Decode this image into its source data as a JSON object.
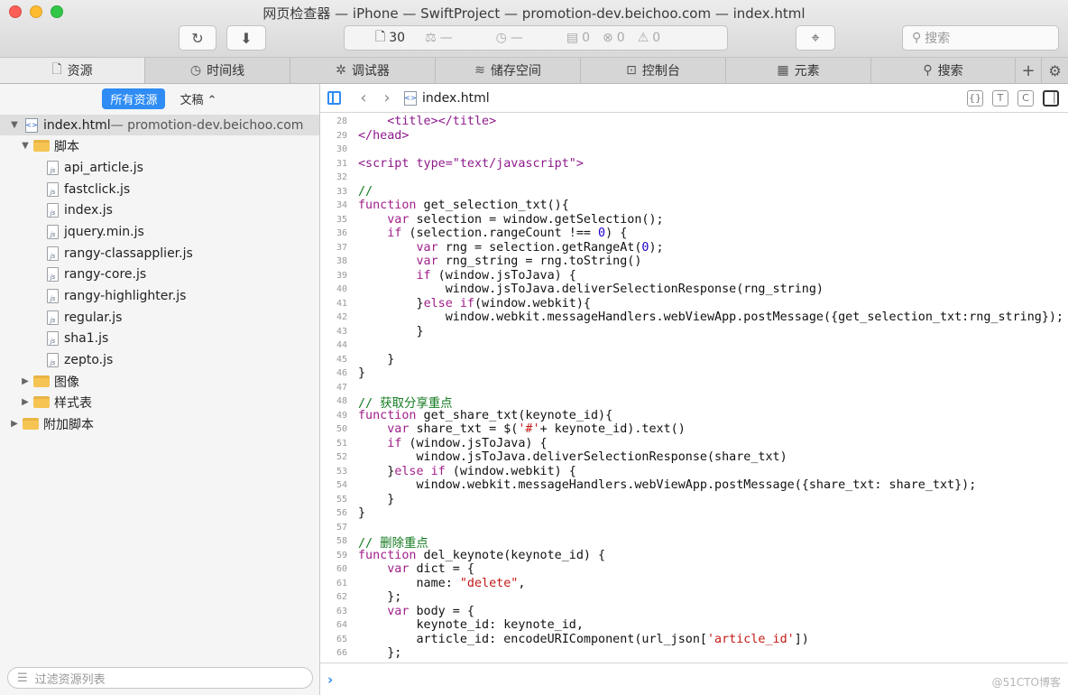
{
  "window": {
    "title": "网页检查器 — iPhone — SwiftProject — promotion-dev.beichoo.com — index.html"
  },
  "toolbar": {
    "reload_icon": "reload-icon",
    "download_icon": "download-icon",
    "resources_count": "30",
    "network_count": "—",
    "time_value": "—",
    "log_count": "0",
    "error_count": "0",
    "warning_count": "0",
    "search_placeholder": "搜索"
  },
  "tabs": [
    {
      "label": "资源",
      "icon": "document-icon"
    },
    {
      "label": "时间线",
      "icon": "clock-icon"
    },
    {
      "label": "调试器",
      "icon": "bug-icon"
    },
    {
      "label": "储存空间",
      "icon": "database-icon"
    },
    {
      "label": "控制台",
      "icon": "console-icon"
    },
    {
      "label": "元素",
      "icon": "elements-icon"
    },
    {
      "label": "搜索",
      "icon": "search-icon"
    }
  ],
  "sidebar": {
    "filter_all": "所有资源",
    "filter_docs": "文稿 ⌃",
    "root": {
      "name": "index.html",
      "sub": " — promotion-dev.beichoo.com"
    },
    "scripts_folder": "脚本",
    "files": [
      "api_article.js",
      "fastclick.js",
      "index.js",
      "jquery.min.js",
      "rangy-classapplier.js",
      "rangy-core.js",
      "rangy-highlighter.js",
      "regular.js",
      "sha1.js",
      "zepto.js"
    ],
    "images_folder": "图像",
    "styles_folder": "样式表",
    "extra_folder": "附加脚本",
    "filter_placeholder": "过滤资源列表"
  },
  "editor": {
    "filename": "index.html",
    "lines": [
      {
        "n": "28",
        "t": "    <title></title>"
      },
      {
        "n": "29",
        "t": "</head>"
      },
      {
        "n": "30",
        "t": ""
      },
      {
        "n": "31",
        "t": "<script type=\"text/javascript\">"
      },
      {
        "n": "32",
        "t": ""
      },
      {
        "n": "33",
        "t": "//"
      },
      {
        "n": "34",
        "t": "function get_selection_txt(){"
      },
      {
        "n": "35",
        "t": "    var selection = window.getSelection();"
      },
      {
        "n": "36",
        "t": "    if (selection.rangeCount !== 0) {"
      },
      {
        "n": "37",
        "t": "        var rng = selection.getRangeAt(0);"
      },
      {
        "n": "38",
        "t": "        var rng_string = rng.toString()"
      },
      {
        "n": "39",
        "t": "        if (window.jsToJava) {"
      },
      {
        "n": "40",
        "t": "            window.jsToJava.deliverSelectionResponse(rng_string)"
      },
      {
        "n": "41",
        "t": "        }else if(window.webkit){"
      },
      {
        "n": "42",
        "t": "            window.webkit.messageHandlers.webViewApp.postMessage({get_selection_txt:rng_string});"
      },
      {
        "n": "43",
        "t": "        }"
      },
      {
        "n": "44",
        "t": ""
      },
      {
        "n": "45",
        "t": "    }"
      },
      {
        "n": "46",
        "t": "}"
      },
      {
        "n": "47",
        "t": ""
      },
      {
        "n": "48",
        "t": "// 获取分享重点"
      },
      {
        "n": "49",
        "t": "function get_share_txt(keynote_id){"
      },
      {
        "n": "50",
        "t": "    var share_txt = $('#'+ keynote_id).text()"
      },
      {
        "n": "51",
        "t": "    if (window.jsToJava) {"
      },
      {
        "n": "52",
        "t": "        window.jsToJava.deliverSelectionResponse(share_txt)"
      },
      {
        "n": "53",
        "t": "    }else if (window.webkit) {"
      },
      {
        "n": "54",
        "t": "        window.webkit.messageHandlers.webViewApp.postMessage({share_txt: share_txt});"
      },
      {
        "n": "55",
        "t": "    }"
      },
      {
        "n": "56",
        "t": "}"
      },
      {
        "n": "57",
        "t": ""
      },
      {
        "n": "58",
        "t": "// 删除重点"
      },
      {
        "n": "59",
        "t": "function del_keynote(keynote_id) {"
      },
      {
        "n": "60",
        "t": "    var dict = {"
      },
      {
        "n": "61",
        "t": "        name: \"delete\","
      },
      {
        "n": "62",
        "t": "    };"
      },
      {
        "n": "63",
        "t": "    var body = {"
      },
      {
        "n": "64",
        "t": "        keynote_id: keynote_id,"
      },
      {
        "n": "65",
        "t": "        article_id: encodeURIComponent(url_json['article_id'])"
      },
      {
        "n": "66",
        "t": "    };"
      }
    ]
  },
  "watermark": "@51CTO博客",
  "colors": {
    "accent": "#2e8cf4",
    "keyword": "#a01f8a",
    "string": "#c41a16",
    "comment": "#137a1f",
    "number": "#1c00cf",
    "tag": "#8e1a8c"
  }
}
